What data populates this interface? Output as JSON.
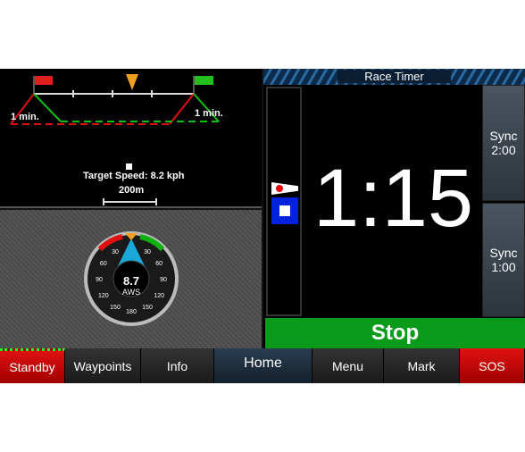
{
  "chart": {
    "left_label": "1 min.",
    "right_label": "1 min.",
    "target_speed": "Target Speed: 8.2 kph",
    "scale": "200m",
    "colors": {
      "port": "#e01010",
      "starboard": "#10c010",
      "mark": "#f0a020"
    }
  },
  "gauge": {
    "value": "8.7",
    "unit": "AWS",
    "ticks": [
      "30",
      "60",
      "90",
      "120",
      "150",
      "180",
      "150",
      "120",
      "90",
      "60",
      "30"
    ]
  },
  "timer": {
    "title": "Race Timer",
    "time": "1:15",
    "sync1": [
      "Sync",
      "2:00"
    ],
    "sync2": [
      "Sync",
      "1:00"
    ],
    "stop": "Stop"
  },
  "bottom": {
    "buttons": [
      "Standby",
      "Waypoints",
      "Info",
      "Home",
      "Menu",
      "Mark",
      "SOS"
    ]
  }
}
